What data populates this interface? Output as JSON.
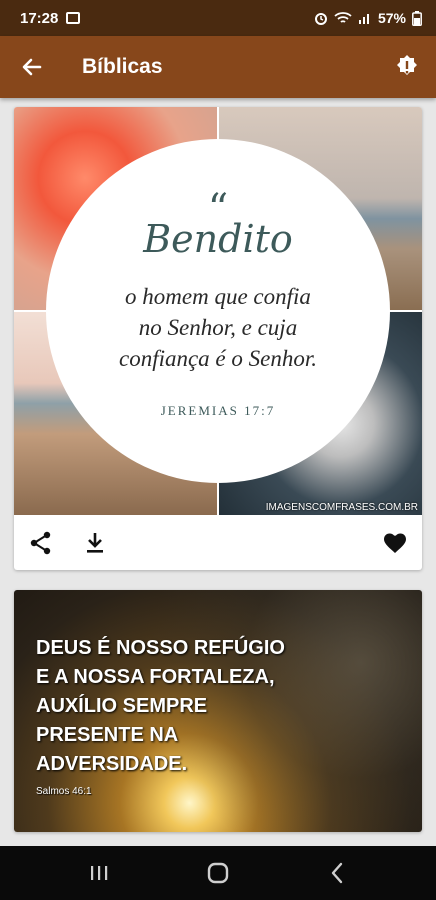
{
  "status": {
    "time": "17:28",
    "battery": "57%",
    "icons": [
      "image-icon",
      "alarm-icon",
      "wifi-icon",
      "signal-icon",
      "battery-icon"
    ]
  },
  "appbar": {
    "title": "Bíblicas",
    "back_icon": "arrow-left-icon",
    "action_icon": "alert-badge-icon"
  },
  "cards": [
    {
      "quote_mark": "“",
      "headline": "Bendito",
      "verse_lines": [
        "o homem que confia",
        "no Senhor, e cuja",
        "confiança é o Senhor."
      ],
      "reference": "JEREMIAS 17:7",
      "watermark": "IMAGENSCOMFRASES.COM.BR",
      "actions": [
        "share-icon",
        "download-icon",
        "heart-icon"
      ]
    },
    {
      "lines": [
        "DEUS É NOSSO REFÚGIO",
        "E A NOSSA FORTALEZA,",
        "AUXÍLIO SEMPRE",
        "PRESENTE NA",
        "ADVERSIDADE."
      ],
      "reference": "Salmos 46:1"
    }
  ],
  "navbar": [
    "recent-apps-icon",
    "home-icon",
    "back-icon"
  ],
  "colors": {
    "statusbar": "#4a2a10",
    "appbar": "#87471b",
    "background": "#e7e7e7"
  }
}
